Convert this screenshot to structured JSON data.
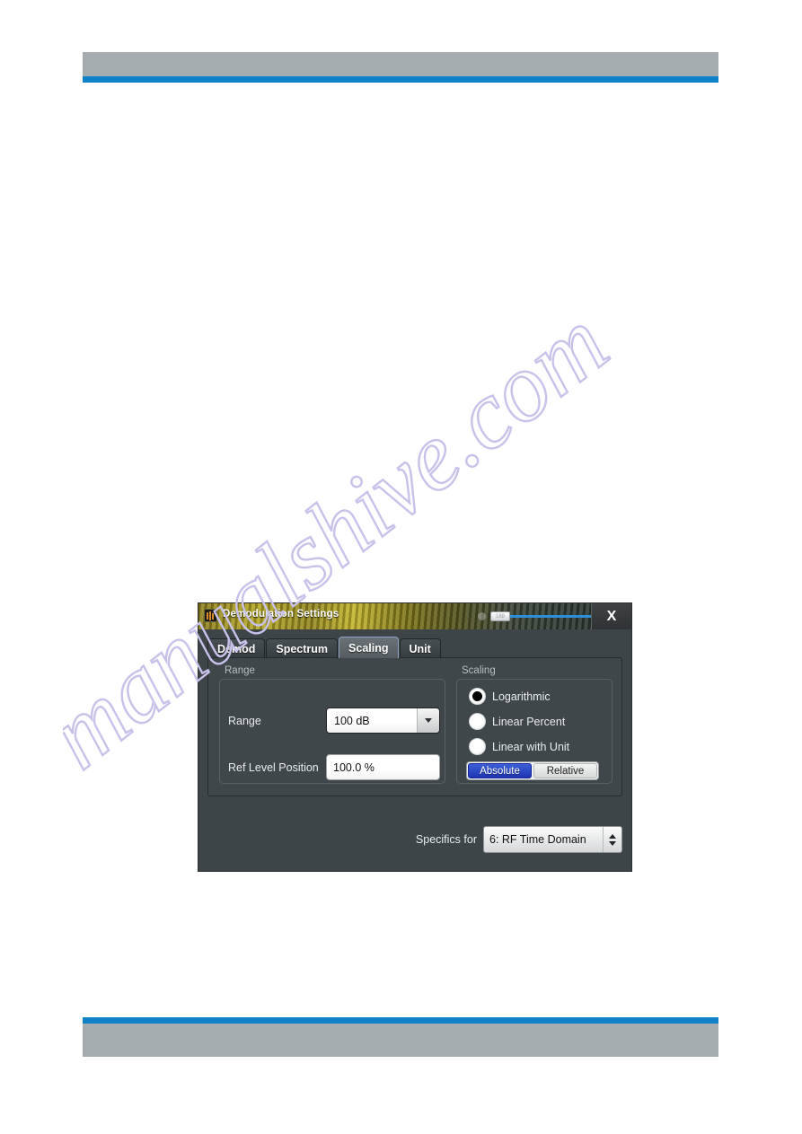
{
  "page": {
    "background": "#ffffff",
    "header_bar_color": "#a6adb1",
    "accent_rule_color": "#1083c8"
  },
  "watermark": {
    "text": "manualshive.com",
    "color": "#c8c2ea"
  },
  "dialog": {
    "title": "Demodulation Settings",
    "icon": "rohde-schwarz-app-icon",
    "close_label": "X",
    "slider": {
      "handle_label": "188"
    },
    "tabs": [
      {
        "label": "Demod",
        "active": false
      },
      {
        "label": "Spectrum",
        "active": false
      },
      {
        "label": "Scaling",
        "active": true
      },
      {
        "label": "Unit",
        "active": false
      }
    ],
    "range_group": {
      "title": "Range",
      "range_label": "Range",
      "range_value": "100 dB",
      "ref_level_label": "Ref Level Position",
      "ref_level_value": "100.0 %"
    },
    "scaling_group": {
      "title": "Scaling",
      "options": [
        {
          "label": "Logarithmic",
          "selected": true
        },
        {
          "label": "Linear Percent",
          "selected": false
        },
        {
          "label": "Linear with Unit",
          "selected": false
        }
      ],
      "toggle": {
        "absolute_label": "Absolute",
        "relative_label": "Relative",
        "selected": "Absolute",
        "selected_color": "#2135b4"
      }
    },
    "footer": {
      "specifics_label": "Specifics for",
      "specifics_value": "6: RF Time Domain"
    }
  }
}
